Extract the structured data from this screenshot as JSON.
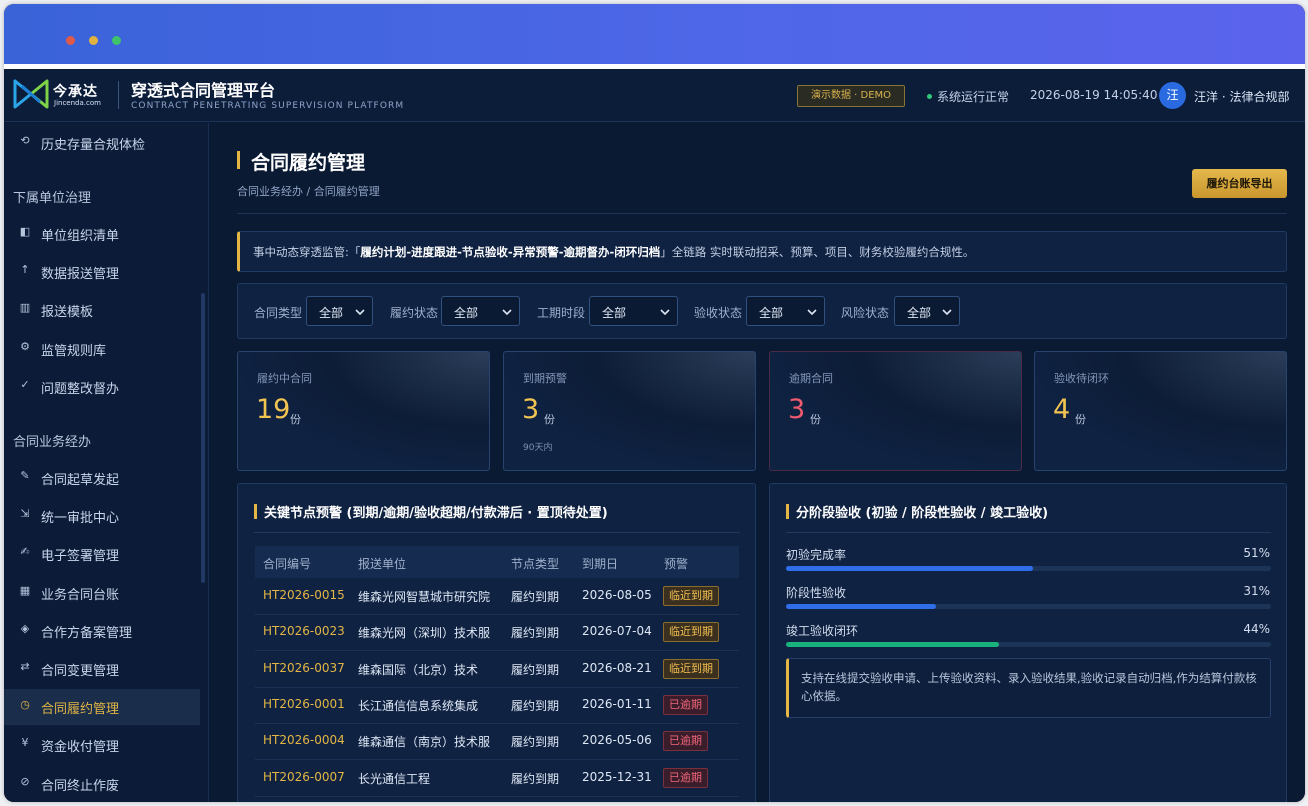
{
  "window": {
    "controls": [
      {
        "name": "close",
        "color": "#e05a4a"
      },
      {
        "name": "minimize",
        "color": "#e2b23e"
      },
      {
        "name": "maximize",
        "color": "#3ec26a"
      }
    ]
  },
  "header": {
    "logo_text": "今承达",
    "logo_sub": "Jincenda.com",
    "title": "穿透式合同管理平台",
    "subtitle": "CONTRACT PENETRATING SUPERVISION PLATFORM",
    "demo_badge": "演示数据 · DEMO",
    "system_status": "系统运行正常",
    "datetime": "2026-08-19 14:05:40",
    "avatar": "汪",
    "user": "汪洋 · 法律合规部"
  },
  "sidebar": {
    "items_top": [
      {
        "icon": "history-icon",
        "glyph": "⟲",
        "label": "历史存量合规体检"
      }
    ],
    "groups": [
      {
        "title": "下属单位治理",
        "items": [
          {
            "icon": "org-list-icon",
            "glyph": "◧",
            "label": "单位组织清单"
          },
          {
            "icon": "upload-icon",
            "glyph": "↑",
            "label": "数据报送管理"
          },
          {
            "icon": "template-icon",
            "glyph": "▥",
            "label": "报送模板"
          },
          {
            "icon": "rules-icon",
            "glyph": "⚙",
            "label": "监管规则库"
          },
          {
            "icon": "check-icon",
            "glyph": "✓",
            "label": "问题整改督办"
          }
        ]
      },
      {
        "title": "合同业务经办",
        "items": [
          {
            "icon": "draft-icon",
            "glyph": "✎",
            "label": "合同起草发起"
          },
          {
            "icon": "approval-icon",
            "glyph": "⇲",
            "label": "统一审批中心"
          },
          {
            "icon": "signature-icon",
            "glyph": "✍",
            "label": "电子签署管理"
          },
          {
            "icon": "ledger-icon",
            "glyph": "▦",
            "label": "业务合同台账"
          },
          {
            "icon": "partner-icon",
            "glyph": "◈",
            "label": "合作方备案管理"
          },
          {
            "icon": "change-icon",
            "glyph": "⇄",
            "label": "合同变更管理"
          },
          {
            "icon": "fulfillment-icon",
            "glyph": "◷",
            "label": "合同履约管理",
            "active": true
          },
          {
            "icon": "payment-icon",
            "glyph": "¥",
            "label": "资金收付管理"
          },
          {
            "icon": "terminate-icon",
            "glyph": "⊘",
            "label": "合同终止作废"
          }
        ]
      }
    ]
  },
  "main": {
    "title": "合同履约管理",
    "breadcrumb": "合同业务经办 / 合同履约管理",
    "export_label": "履约台账导出",
    "notice": {
      "prefix": "事中动态穿透监管:「",
      "bold": "履约计划-进度跟进-节点验收-异常预警-逾期督办-闭环归档",
      "suffix": "」全链路 实时联动招采、预算、项目、财务校验履约合规性。"
    },
    "filters": [
      {
        "label": "合同类型",
        "value": "全部"
      },
      {
        "label": "履约状态",
        "value": "全部"
      },
      {
        "label": "工期时段",
        "value": "全部"
      },
      {
        "label": "验收状态",
        "value": "全部"
      },
      {
        "label": "风险状态",
        "value": "全部"
      }
    ],
    "stats": [
      {
        "label": "履约中合同",
        "value": "19",
        "unit": "份",
        "sub": ""
      },
      {
        "label": "到期预警",
        "value": "3",
        "unit": "份",
        "sub": "90天内"
      },
      {
        "label": "逾期合同",
        "value": "3",
        "unit": "份",
        "sub": ""
      },
      {
        "label": "验收待闭环",
        "value": "4",
        "unit": "份",
        "sub": ""
      }
    ],
    "alerts": {
      "title": "关键节点预警 (到期/逾期/验收超期/付款滞后 · 置顶待处置)",
      "columns": [
        "合同编号",
        "报送单位",
        "节点类型",
        "到期日",
        "预警"
      ],
      "rows": [
        {
          "code": "HT2026-0015",
          "unit": "维森光网智慧城市研究院",
          "type": "履约到期",
          "date": "2026-08-05",
          "tag": "临近到期",
          "level": "warn"
        },
        {
          "code": "HT2026-0023",
          "unit": "维森光网（深圳）技术服",
          "type": "履约到期",
          "date": "2026-07-04",
          "tag": "临近到期",
          "level": "warn"
        },
        {
          "code": "HT2026-0037",
          "unit": "维森国际（北京）技术",
          "type": "履约到期",
          "date": "2026-08-21",
          "tag": "临近到期",
          "level": "warn"
        },
        {
          "code": "HT2026-0001",
          "unit": "长江通信信息系统集成",
          "type": "履约到期",
          "date": "2026-01-11",
          "tag": "已逾期",
          "level": "over"
        },
        {
          "code": "HT2026-0004",
          "unit": "维森通信（南京）技术服",
          "type": "履约到期",
          "date": "2026-05-06",
          "tag": "已逾期",
          "level": "over"
        },
        {
          "code": "HT2026-0007",
          "unit": "长光通信工程",
          "type": "履约到期",
          "date": "2025-12-31",
          "tag": "已逾期",
          "level": "over"
        }
      ]
    },
    "acceptance": {
      "title": "分阶段验收 (初验 / 阶段性验收 / 竣工验收)",
      "items": [
        {
          "label": "初验完成率",
          "percent_text": "51%",
          "value": 0.51,
          "color": "#2f6ee8"
        },
        {
          "label": "阶段性验收",
          "percent_text": "31%",
          "value": 0.31,
          "color": "#2f6ee8"
        },
        {
          "label": "竣工验收闭环",
          "percent_text": "44%",
          "value": 0.44,
          "color": "#19b27c"
        }
      ],
      "note": "支持在线提交验收申请、上传验收资料、录入验收结果,验收记录自动归档,作为结算付款核心依据。"
    }
  }
}
